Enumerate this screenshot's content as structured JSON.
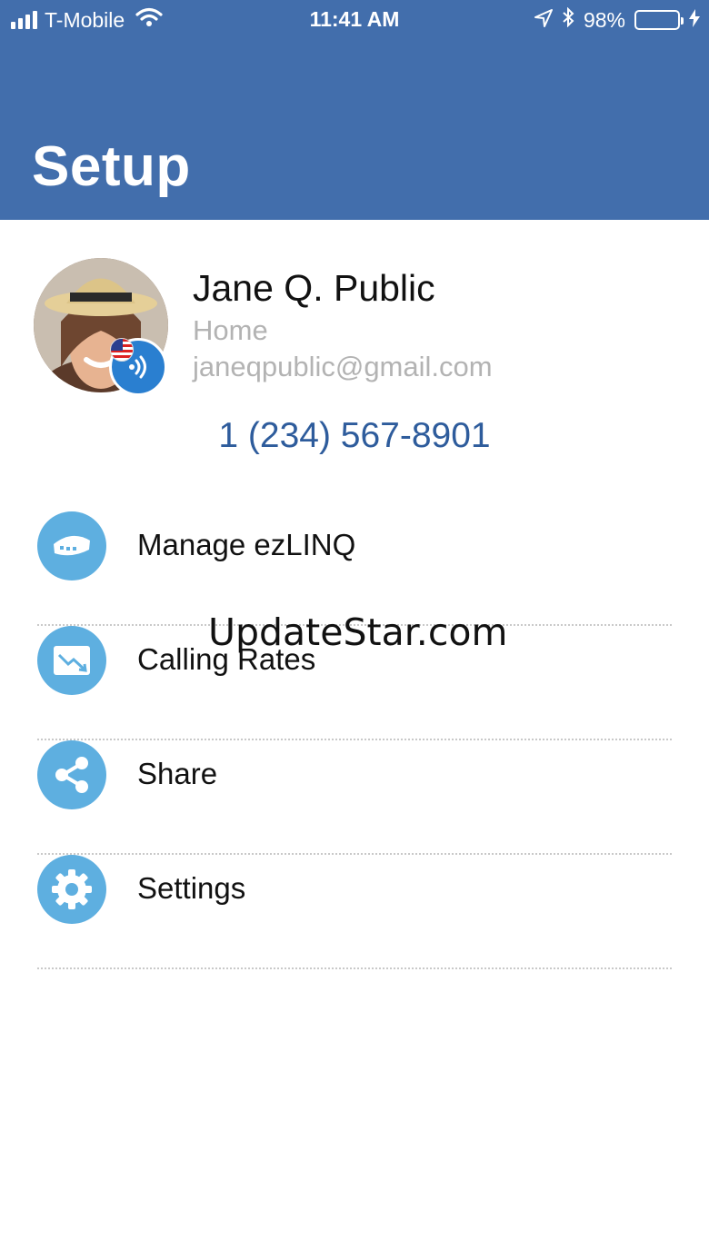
{
  "colors": {
    "header": "#426eac",
    "link": "#2e5c9c",
    "icon_bg": "#5eafe0",
    "badge": "#2a7fd0"
  },
  "status_bar": {
    "carrier": "T-Mobile",
    "time": "11:41 AM",
    "battery": "98%",
    "battery_level": 0.98,
    "icons": [
      "signal-icon",
      "wifi-icon",
      "location-arrow-icon",
      "bluetooth-icon",
      "battery-icon",
      "charging-bolt-icon"
    ]
  },
  "header": {
    "title": "Setup"
  },
  "profile": {
    "name": "Jane Q. Public",
    "label": "Home",
    "email": "janeqpublic@gmail.com",
    "phone": "1 (234) 567-8901",
    "icons": [
      "avatar",
      "us-flag-icon",
      "wifi-calling-icon"
    ]
  },
  "menu": {
    "items": [
      {
        "label": "Manage ezLINQ",
        "icon": "ezlinq-device-icon"
      },
      {
        "label": "Calling Rates",
        "icon": "rates-chart-icon"
      },
      {
        "label": "Share",
        "icon": "share-icon"
      },
      {
        "label": "Settings",
        "icon": "gear-icon"
      }
    ]
  },
  "watermark": "UpdateStar.com"
}
